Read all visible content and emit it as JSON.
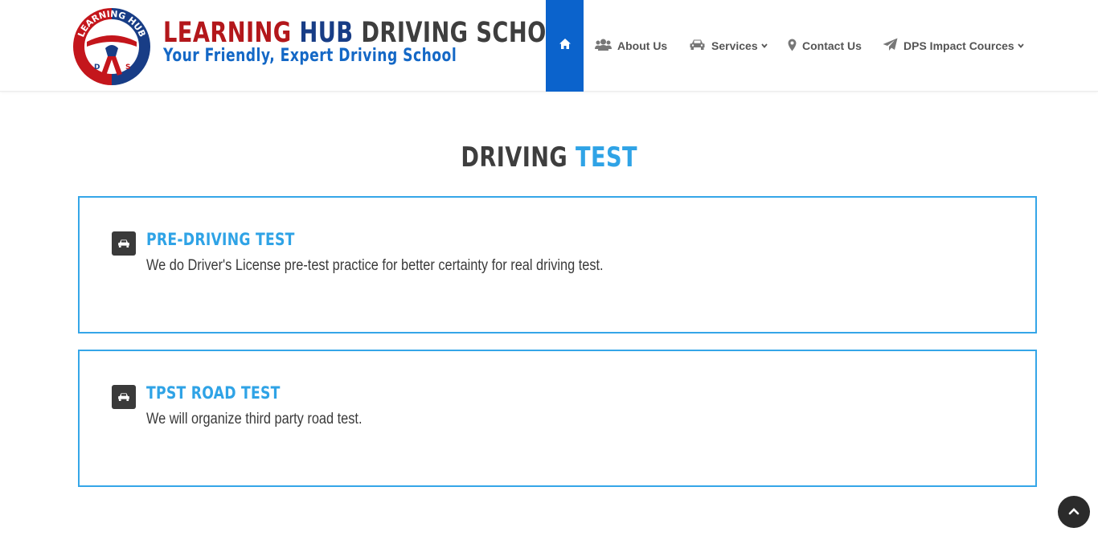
{
  "brand": {
    "logo_ring_text": "LEARNING HUB",
    "logo_letters": [
      "D",
      "S"
    ],
    "title_part1": "LEARNING",
    "title_part2": "HUB",
    "title_part3": "DRIVING SCHOOL",
    "tagline": "Your Friendly, Expert Driving School"
  },
  "nav": {
    "home_icon": "home-icon",
    "items": [
      {
        "label": "About Us",
        "icon": "users-icon"
      },
      {
        "label": "Services",
        "icon": "car-icon",
        "dropdown": true
      },
      {
        "label": "Contact Us",
        "icon": "map-marker-icon"
      },
      {
        "label": "DPS Impact Cources",
        "icon": "paper-plane-icon",
        "dropdown": true
      }
    ]
  },
  "section": {
    "title_dark": "DRIVING",
    "title_accent": "TEST"
  },
  "cards": [
    {
      "icon": "car-icon",
      "title": "PRE-DRIVING TEST",
      "text": "We do Driver's License pre-test practice for better certainty for real driving test."
    },
    {
      "icon": "car-icon",
      "title": "TPST ROAD TEST",
      "text": "We will organize third party road test."
    }
  ],
  "colors": {
    "brand_red": "#b3171b",
    "brand_navy": "#183d86",
    "nav_active": "#0b63cc",
    "accent": "#2fa3e6",
    "card_border": "#35a6e8"
  }
}
